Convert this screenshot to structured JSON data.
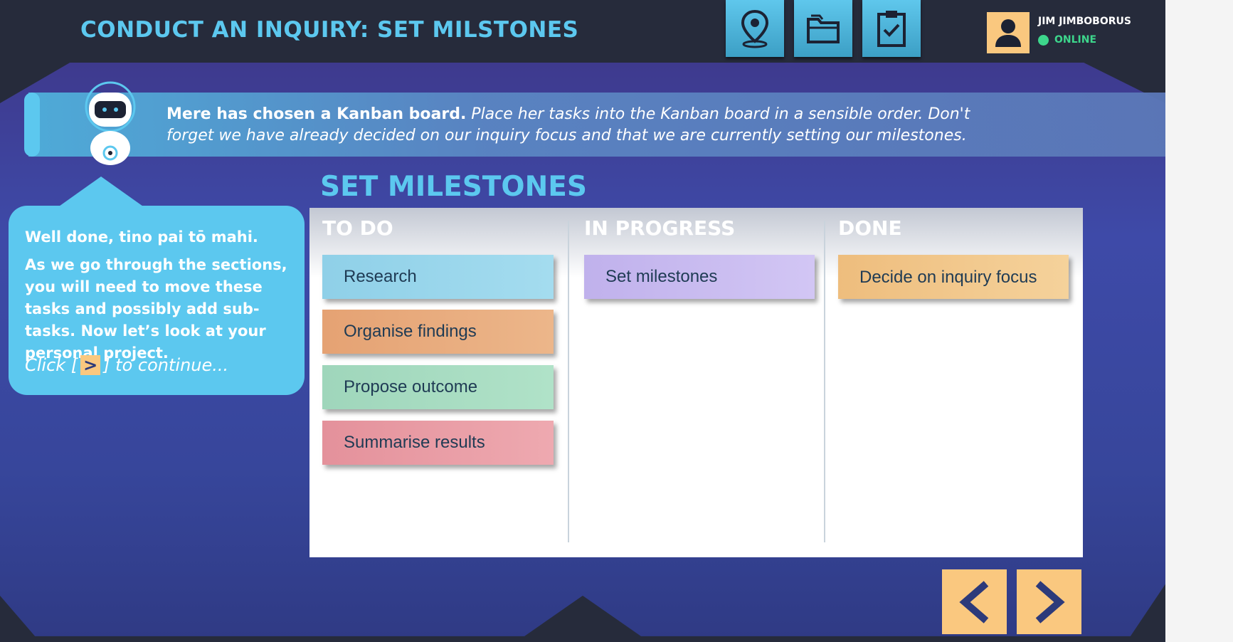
{
  "header": {
    "title": "CONDUCT AN INQUIRY: SET MILSTONES",
    "tools": [
      {
        "icon": "map-pin-icon"
      },
      {
        "icon": "folder-icon"
      },
      {
        "icon": "clipboard-check-icon"
      }
    ],
    "user": {
      "name": "JIM JIMBOBORUS",
      "status": "ONLINE"
    }
  },
  "intro": {
    "lead": "Mere has chosen a Kanban board.",
    "rest": " Place her tasks into the Kanban board in a sensible order. Don't forget we have already decided on our inquiry focus and that we are currently setting our milestones."
  },
  "bubble": {
    "line1": "Well done, tino pai tō mahi.",
    "line2": "As we go through the sections, you will need to move these tasks and possibly add sub-tasks. Now let’s look at your personal project.",
    "click_prefix": "Click [",
    "click_key": ">",
    "click_suffix": "] to continue..."
  },
  "board": {
    "title": "SET MILESTONES",
    "columns": [
      {
        "heading": "TO DO"
      },
      {
        "heading": "IN PROGRESS"
      },
      {
        "heading": "DONE"
      }
    ],
    "cards": {
      "todo": [
        "Research",
        "Organise findings",
        "Propose outcome",
        "Summarise results"
      ],
      "in_progress": [
        "Set milestones"
      ],
      "done": [
        "Decide on inquiry focus"
      ]
    }
  },
  "colors": {
    "accent": "#5cc8ef",
    "highlight": "#fac87f",
    "online": "#3dd68c",
    "card_research": "#94d6ec",
    "card_organise": "#e9ab7c",
    "card_propose": "#a5dcc0",
    "card_summarise": "#e99aa3",
    "card_milestones": "#c8baf0",
    "card_decide": "#f1c78a"
  },
  "nav": {
    "prev_icon": "chevron-left-icon",
    "next_icon": "chevron-right-icon"
  }
}
